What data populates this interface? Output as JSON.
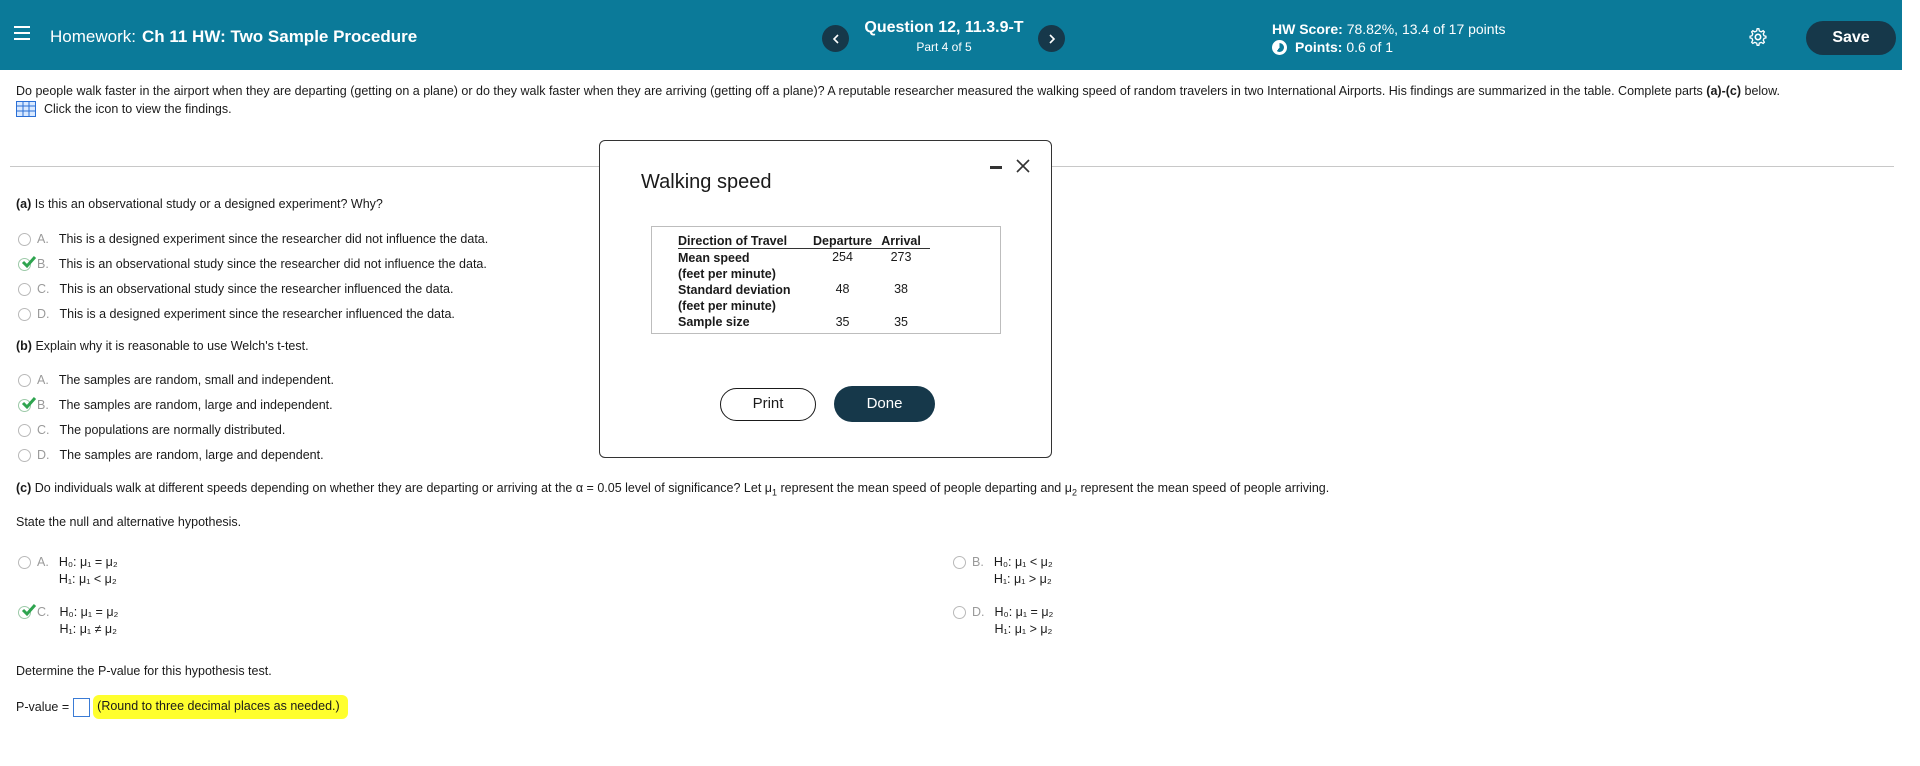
{
  "header": {
    "homework_prefix": "Homework:",
    "homework_title": "Ch 11 HW: Two Sample Procedure",
    "prev_icon": "chevron-left-icon",
    "next_icon": "chevron-right-icon",
    "question_title": "Question 12, 11.3.9-T",
    "question_part": "Part 4 of 5",
    "hw_score_label": "HW Score:",
    "hw_score_value": "78.82%, 13.4 of 17 points",
    "points_label": "Points:",
    "points_value": "0.6 of 1",
    "save_label": "Save",
    "bar_color": "#0b7a99",
    "button_color": "#16384a"
  },
  "intro": {
    "text": "Do people walk faster in the airport when they are departing (getting on a plane) or do they walk faster when they are arriving (getting off a plane)? A reputable researcher measured the walking speed of random travelers in two International Airports. His findings are summarized in the table. Complete parts",
    "text_bold": "(a)-(c)",
    "text_end": "below.",
    "findings_link": "Click the icon to view the findings."
  },
  "part_a": {
    "question_bold": "(a)",
    "question": "Is this an observational study or a designed experiment? Why?",
    "options": [
      {
        "letter": "A.",
        "text": "This is a designed experiment since the researcher did not influence the data.",
        "selected": false
      },
      {
        "letter": "B.",
        "text": "This is an observational study since the researcher did not influence the data.",
        "selected": true
      },
      {
        "letter": "C.",
        "text": "This is an observational study since the researcher influenced the data.",
        "selected": false
      },
      {
        "letter": "D.",
        "text": "This is a designed experiment since the researcher influenced the data.",
        "selected": false
      }
    ]
  },
  "part_b": {
    "question_bold": "(b)",
    "question": "Explain why it is reasonable to use Welch's t-test.",
    "options": [
      {
        "letter": "A.",
        "text": "The samples are random, small and independent.",
        "selected": false
      },
      {
        "letter": "B.",
        "text": "The samples are random, large and independent.",
        "selected": true
      },
      {
        "letter": "C.",
        "text": "The populations are normally distributed.",
        "selected": false
      },
      {
        "letter": "D.",
        "text": "The samples are random, large and dependent.",
        "selected": false
      }
    ]
  },
  "part_c": {
    "question_bold": "(c)",
    "q1": "Do individuals walk at different speeds depending on whether they are departing or arriving at the α = 0.05 level of significance? Let μ",
    "q2": "represent the mean speed of people departing and μ",
    "q3": "represent the mean speed of people arriving.",
    "sub1": "1",
    "sub2": "2",
    "state": "State the null and alternative hypothesis.",
    "options": [
      {
        "letter": "A.",
        "h0": "H₀: μ₁ = μ₂",
        "h1": "H₁: μ₁ < μ₂",
        "selected": false
      },
      {
        "letter": "B.",
        "h0": "H₀: μ₁ < μ₂",
        "h1": "H₁: μ₁ > μ₂",
        "selected": false
      },
      {
        "letter": "C.",
        "h0": "H₀: μ₁ = μ₂",
        "h1": "H₁: μ₁ ≠ μ₂",
        "selected": true
      },
      {
        "letter": "D.",
        "h0": "H₀: μ₁ = μ₂",
        "h1": "H₁: μ₁ > μ₂",
        "selected": false
      }
    ],
    "determine": "Determine the P-value for this hypothesis test.",
    "pvalue_label": "P-value =",
    "pvalue_value": "",
    "round_note": "(Round to three decimal places as needed.)",
    "highlight_color": "#ffff2e"
  },
  "modal": {
    "title": "Walking speed",
    "minimize_icon": "minimize-icon",
    "close_icon": "close-icon",
    "table": {
      "headers": [
        "Direction of Travel",
        "Departure",
        "Arrival"
      ],
      "rows": [
        {
          "label1": "Mean speed",
          "label2": "(feet per minute)",
          "departure": "254",
          "arrival": "273"
        },
        {
          "label1": "Standard deviation",
          "label2": "(feet per minute)",
          "departure": "48",
          "arrival": "38"
        },
        {
          "label1": "Sample size",
          "label2": "",
          "departure": "35",
          "arrival": "35"
        }
      ]
    },
    "print_label": "Print",
    "done_label": "Done"
  }
}
